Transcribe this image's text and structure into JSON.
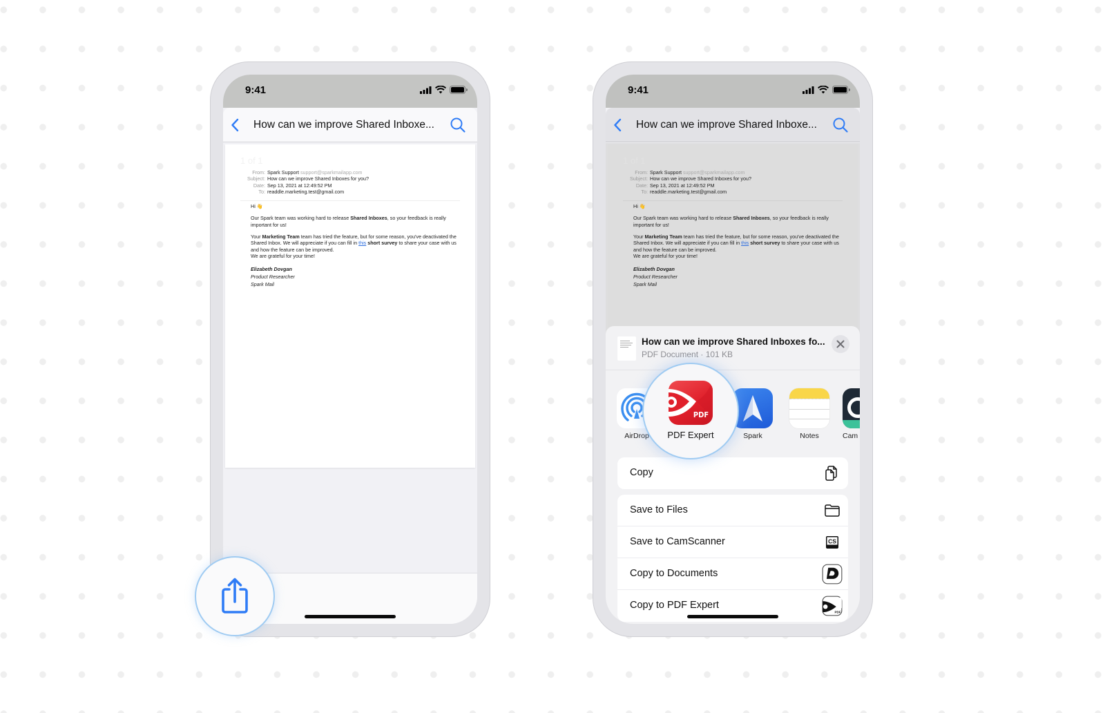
{
  "status": {
    "time": "9:41"
  },
  "nav": {
    "title": "How can we improve Shared Inboxe..."
  },
  "email": {
    "page_counter": "1 of 1",
    "headers": [
      {
        "key": "From:",
        "value": "Spark Support",
        "sub": "support@sparkmailapp.com"
      },
      {
        "key": "Subject:",
        "value": "How can we improve Shared Inboxes for you?",
        "sub": ""
      },
      {
        "key": "Date:",
        "value": "Sep 13, 2021 at 12:49:52 PM",
        "sub": ""
      },
      {
        "key": "To:",
        "value": "readdle.marketing.test@gmail.com",
        "sub": ""
      }
    ],
    "greeting": "Hi 👋",
    "p1_a": "Our Spark team was working hard to release ",
    "p1_b": "Shared Inboxes",
    "p1_c": ", so your feedback is really important for us!",
    "p2_a": "Your ",
    "p2_b": "Marketing Team",
    "p2_c": " team has tried the feature, but for some reason, you've deactivated the Shared Inbox. We will appreciate if you can fill in ",
    "p2_link": "this",
    "p2_d": " short survey",
    "p2_e": " to share your case with us and how the feature can be improved.",
    "p2_f": "We are grateful for your time!",
    "sig_name": "Elizabeth Dovgan",
    "sig_role": "Product Researcher",
    "sig_company": "Spark Mail"
  },
  "share_sheet": {
    "doc_title": "How can we improve Shared Inboxes fo...",
    "doc_meta": "PDF Document · 101 KB",
    "apps": [
      {
        "label": "AirDrop",
        "icon": "airdrop-icon"
      },
      {
        "label": "PDF Expert",
        "icon": "pdf-expert-icon"
      },
      {
        "label": "Spark",
        "icon": "spark-icon"
      },
      {
        "label": "Notes",
        "icon": "notes-icon"
      },
      {
        "label": "Cam",
        "icon": "camscanner-icon"
      }
    ],
    "actions_top": [
      {
        "label": "Copy",
        "icon": "copy-icon"
      }
    ],
    "actions": [
      {
        "label": "Save to Files",
        "icon": "folder-icon"
      },
      {
        "label": "Save to CamScanner",
        "icon": "camscanner-icon"
      },
      {
        "label": "Copy to Documents",
        "icon": "documents-icon"
      },
      {
        "label": "Copy to PDF Expert",
        "icon": "pdf-expert-icon"
      }
    ]
  },
  "colors": {
    "accent": "#2f7cf6",
    "callout_ring": "#9fcbf2",
    "pdf_expert_red": "#e8252f",
    "spark_blue": "#2a6fe0",
    "notes_yellow": "#f9d649"
  }
}
